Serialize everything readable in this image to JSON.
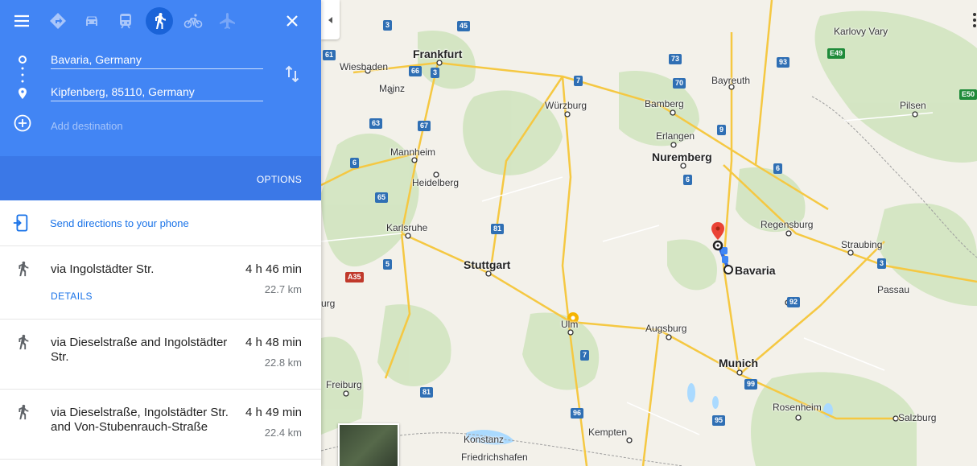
{
  "modes": [
    {
      "name": "best-route",
      "icon": "directions-icon"
    },
    {
      "name": "driving",
      "icon": "car-icon"
    },
    {
      "name": "transit",
      "icon": "train-icon"
    },
    {
      "name": "walking",
      "icon": "walk-icon",
      "active": true
    },
    {
      "name": "cycling",
      "icon": "bicycle-icon"
    },
    {
      "name": "flights",
      "icon": "airplane-icon"
    }
  ],
  "header": {
    "menu_icon": "menu-icon",
    "close_icon": "close-icon",
    "swap_icon": "swap-icon"
  },
  "waypoints": {
    "origin": "Bavaria, Germany",
    "destination": "Kipfenberg, 85110, Germany",
    "add_placeholder": "Add destination"
  },
  "options_label": "OPTIONS",
  "send_to_phone": "Send directions to your phone",
  "routes": [
    {
      "name": "via Ingolstädter Str.",
      "time": "4 h 46 min",
      "distance": "22.7 km",
      "details": "DETAILS"
    },
    {
      "name": "via Dieselstraße and Ingolstädter Str.",
      "time": "4 h 48 min",
      "distance": "22.8 km"
    },
    {
      "name": "via Dieselstraße, Ingolstädter Str. and Von-Stubenrauch-Straße",
      "time": "4 h 49 min",
      "distance": "22.4 km"
    }
  ],
  "map": {
    "cities": {
      "frankfurt": "Frankfurt",
      "wiesbaden": "Wiesbaden",
      "mainz": "Mainz",
      "wurzburg": "Würzburg",
      "bamberg": "Bamberg",
      "bayreuth": "Bayreuth",
      "karlovy_vary": "Karlovy Vary",
      "erlangen": "Erlangen",
      "nuremberg": "Nuremberg",
      "pilsen": "Pilsen",
      "mannheim": "Mannheim",
      "heidelberg": "Heidelberg",
      "regensburg": "Regensburg",
      "straubing": "Straubing",
      "karlsruhe": "Karlsruhe",
      "stuttgart": "Stuttgart",
      "bavaria": "Bavaria",
      "passau": "Passau",
      "ulm": "Ulm",
      "augsburg": "Augsburg",
      "munich": "Munich",
      "freiburg": "Freiburg",
      "rosenheim": "Rosenheim",
      "salzburg": "Salzburg",
      "kempten": "Kempten",
      "konstanz": "Konstanz",
      "friedrichshafen": "Friedrichshafen",
      "burg": "urg"
    },
    "shields": [
      "3",
      "45",
      "61",
      "66",
      "3",
      "73",
      "93",
      "E49",
      "7",
      "70",
      "63",
      "67",
      "9",
      "E50",
      "6",
      "65",
      "6",
      "6",
      "81",
      "5",
      "A35",
      "3",
      "92",
      "81",
      "7",
      "96",
      "99",
      "95"
    ]
  },
  "colors": {
    "header_blue": "#4285f4",
    "options_blue": "#3b78e7",
    "link_blue": "#1a73e8",
    "route_blue": "#3367d6",
    "pin_red": "#ea4335"
  }
}
